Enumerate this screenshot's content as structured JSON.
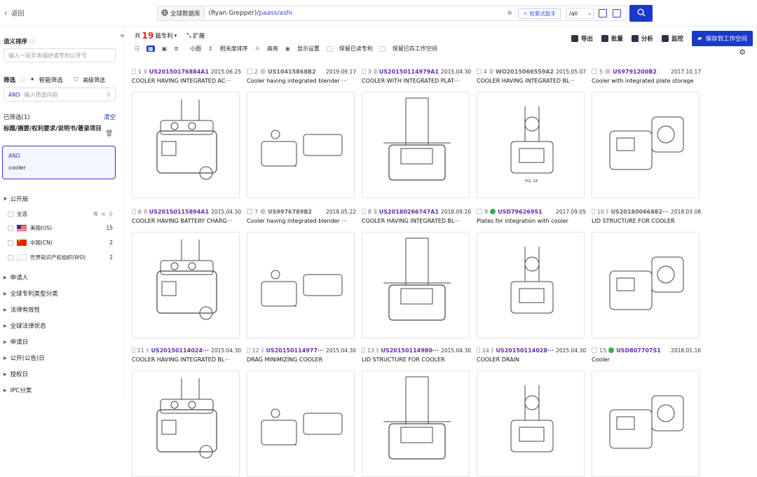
{
  "topbar": {
    "back_label": "返回",
    "db_label": "全球数据库",
    "query_prefix": "(Ryan Grepper)/",
    "query_highlight": "paass/ashi",
    "assist_label": "检索式助手",
    "field_select": "/all"
  },
  "sidebar": {
    "semantic_title": "语义排序",
    "semantic_placeholder": "输入一段文本描述或专利公开号",
    "filter_title": "筛选",
    "smart_filter": "智能筛选",
    "advanced_filter": "高级筛选",
    "filter_op": "AND",
    "filter_placeholder": "输入筛选内容",
    "selected_title": "已筛选(1)",
    "clear_label": "清空",
    "selected_field": "标题/摘要/权利要求/说明书/著录项目",
    "selected_op": "AND",
    "selected_value": "cooler",
    "authority_title": "公开局",
    "all_label": "全选",
    "n_label": "N",
    "countries": [
      {
        "name": "美国(US)",
        "count": "15"
      },
      {
        "name": "中国(CN)",
        "count": "2"
      },
      {
        "name": "世界知识产权组织(WO)",
        "count": "2"
      }
    ],
    "facets": [
      "申请人",
      "全球专利类型分类",
      "法律有效性",
      "全球法律状态",
      "申请日",
      "公开(公告)日",
      "授权日",
      "IPC分类"
    ]
  },
  "toolbar": {
    "count_prefix": "共",
    "count": "19",
    "count_suffix": "篇专利",
    "expand": "扩展",
    "small_image": "小图",
    "relevance_sort": "相关度排序",
    "highlight": "高亮",
    "display_settings": "显示设置",
    "save_read": "保留已读专利",
    "save_workspace_item": "保留已存工作空间",
    "export": "导出",
    "batch": "批量",
    "analysis": "分析",
    "monitor": "监控",
    "save_to_workspace": "保存到工作空间"
  },
  "patents": [
    {
      "num": "1",
      "pn": "US20150176884A1",
      "date": "2015.06.25",
      "title": "COOLER HAVING INTEGRATED AC···",
      "status": "grey",
      "pn_color": "#6a2bb4"
    },
    {
      "num": "2",
      "pn": "US10415868B2",
      "date": "2019.09.17",
      "title": "Cooler having integrated blender ···",
      "status": "grey",
      "pn_color": "#666666"
    },
    {
      "num": "3",
      "pn": "US20150114979A1",
      "date": "2015.04.30",
      "title": "COOLER WITH INTEGRATED PLAT···",
      "status": "grey",
      "pn_color": "#6a2bb4"
    },
    {
      "num": "4",
      "pn": "WO2015066559A2",
      "date": "2015.05.07",
      "title": "COOLER HAVING INTEGRATED BL···",
      "status": "grey",
      "pn_color": "#666666"
    },
    {
      "num": "5",
      "pn": "US9791200B2",
      "date": "2017.10.17",
      "title": "Cooler with integrated plate storage",
      "status": "grey",
      "pn_color": "#6a2bb4"
    },
    {
      "num": "6",
      "pn": "US20150115894A1",
      "date": "2015.04.30",
      "title": "COOLER HAVING BATTERY CHARG···",
      "status": "grey",
      "pn_color": "#6a2bb4"
    },
    {
      "num": "7",
      "pn": "US9976789B2",
      "date": "2018.05.22",
      "title": "Cooler having integrated blender ···",
      "status": "grey",
      "pn_color": "#666666"
    },
    {
      "num": "8",
      "pn": "US20180266747A1",
      "date": "2018.09.20",
      "title": "COOLER HAVING INTEGRATED BL···",
      "status": "grey",
      "pn_color": "#6a2bb4"
    },
    {
      "num": "9",
      "pn": "USD796269S1",
      "date": "2017.09.05",
      "title": "Plates for integration with cooler",
      "status": "green",
      "pn_color": "#6a2bb4"
    },
    {
      "num": "10",
      "pn": "US20180066882···",
      "date": "2018.03.08",
      "title": "LID STRUCTURE FOR COOLER",
      "status": "grey",
      "pn_color": "#666666"
    },
    {
      "num": "11",
      "pn": "US20150114024···",
      "date": "2015.04.30",
      "title": "COOLER HAVING INTEGRATED BL···",
      "status": "grey",
      "pn_color": "#6a2bb4"
    },
    {
      "num": "12",
      "pn": "US20150114977···",
      "date": "2015.04.30",
      "title": "DRAG MINIMIZING COOLER",
      "status": "grey",
      "pn_color": "#6a2bb4"
    },
    {
      "num": "13",
      "pn": "US20150114980···",
      "date": "2015.04.30",
      "title": "LID STRUCTURE FOR COOLER",
      "status": "grey",
      "pn_color": "#6a2bb4"
    },
    {
      "num": "14",
      "pn": "US20150114028···",
      "date": "2015.04.30",
      "title": "COOLER DRAIN",
      "status": "grey",
      "pn_color": "#6a2bb4"
    },
    {
      "num": "15",
      "pn": "USD807707S1",
      "date": "2018.01.16",
      "title": "Cooler",
      "status": "green",
      "pn_color": "#6a2bb4"
    }
  ],
  "figure_label": "FIG. 1A",
  "colors": {
    "accent": "#1b39c9",
    "count_red": "#e02020",
    "valid_green": "#2fb44a",
    "pn_purple": "#6a2bb4"
  }
}
